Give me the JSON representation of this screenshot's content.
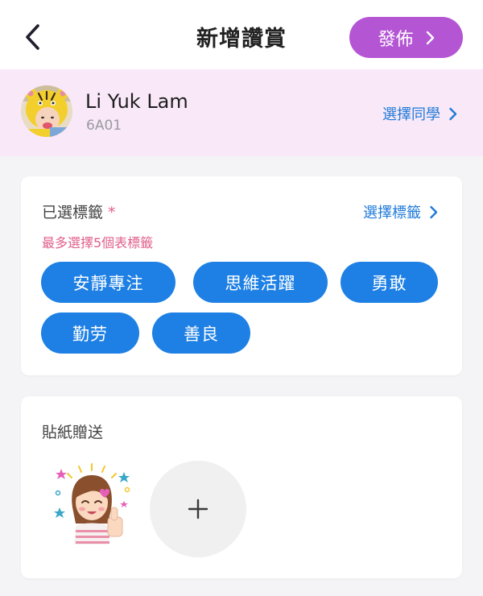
{
  "header": {
    "title": "新增讚賞",
    "publish_label": "發佈",
    "back_icon": "chevron-left-icon"
  },
  "student": {
    "name": "Li Yuk Lam",
    "class": "6A01",
    "select_label": "選擇同學"
  },
  "tags_section": {
    "label": "已選標籤",
    "required_mark": "*",
    "select_label": "選擇標籤",
    "hint": "最多選擇5個表標籤",
    "tags": [
      "安靜專注",
      "思維活躍",
      "勇敢",
      "勤劳",
      "善良"
    ]
  },
  "sticker_section": {
    "label": "貼紙贈送",
    "add_icon": "plus-icon"
  },
  "colors": {
    "accent_purple": "#b455d4",
    "tag_blue": "#1e80e4",
    "link_blue": "#1f7ad8",
    "hint_pink": "#e0608a",
    "student_bar_bg": "#f8e8f8"
  }
}
